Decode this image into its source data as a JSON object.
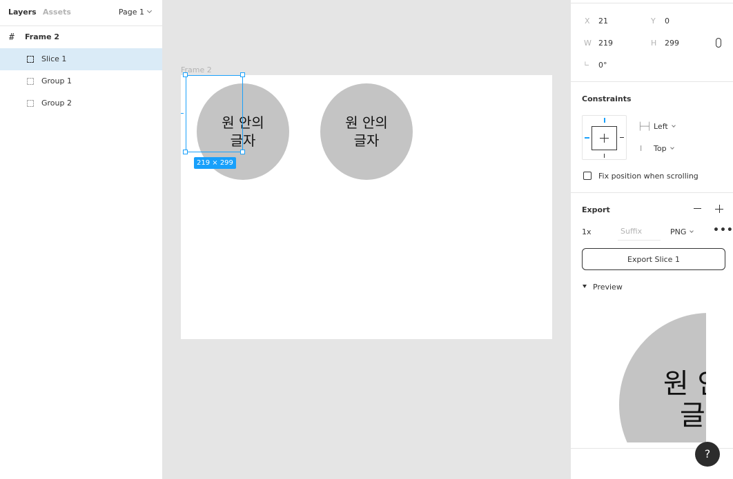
{
  "left_panel": {
    "tabs": [
      "Layers",
      "Assets"
    ],
    "page": "Page 1",
    "layers": [
      {
        "label": "Frame 2",
        "icon": "hash-icon"
      },
      {
        "label": "Slice 1",
        "icon": "slice-icon",
        "selected": true
      },
      {
        "label": "Group 1",
        "icon": "group-icon"
      },
      {
        "label": "Group 2",
        "icon": "group-icon"
      }
    ]
  },
  "canvas": {
    "frame_label": "Frame 2",
    "circle_text_1": "원 안의",
    "circle_text_2": "글자",
    "selection_size": "219 × 299",
    "accent_color": "#18a0fb"
  },
  "properties": {
    "x_label": "X",
    "x": "21",
    "y_label": "Y",
    "y": "0",
    "w_label": "W",
    "w": "219",
    "h_label": "H",
    "h": "299",
    "rotation_icon": "angle-icon",
    "rotation": "0°"
  },
  "constraints": {
    "title": "Constraints",
    "horizontal": "Left",
    "vertical": "Top",
    "fix_scroll_label": "Fix position when scrolling"
  },
  "export": {
    "title": "Export",
    "scale": "1x",
    "suffix_placeholder": "Suffix",
    "format": "PNG",
    "button": "Export Slice 1",
    "preview_label": "Preview",
    "preview_text_1": "원 안",
    "preview_text_2": "글"
  },
  "help": "?"
}
